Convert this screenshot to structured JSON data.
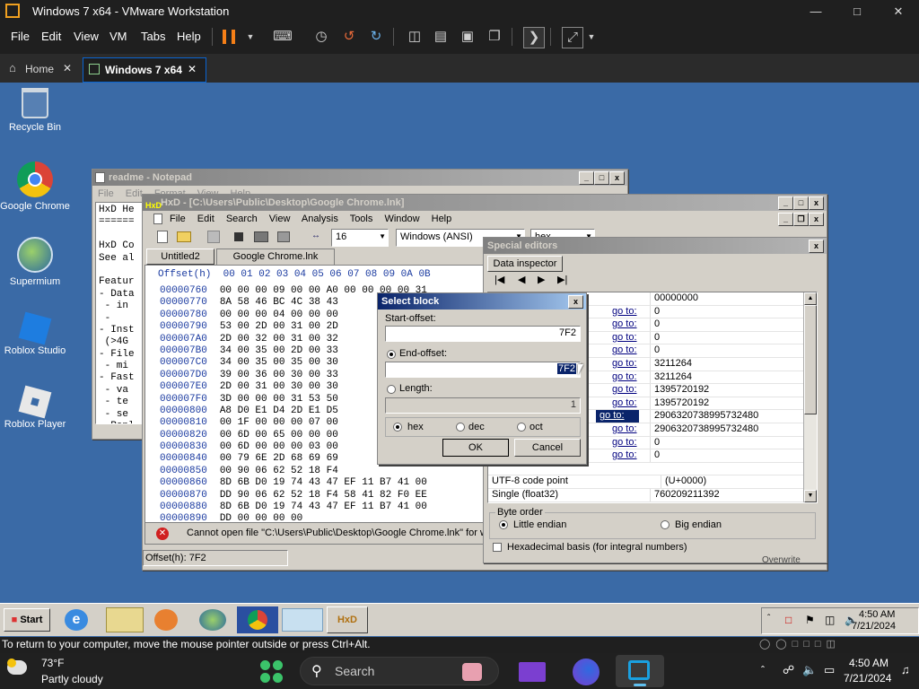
{
  "vmware": {
    "title": "Windows 7 x64 - VMware Workstation",
    "menu": [
      "File",
      "Edit",
      "View",
      "VM",
      "Tabs",
      "Help"
    ],
    "tabs": [
      {
        "label": "Home"
      },
      {
        "label": "Windows 7 x64"
      }
    ],
    "status_message": "To return to your computer, move the mouse pointer outside or press Ctrl+Alt."
  },
  "desktop": {
    "icons": [
      {
        "label": "Recycle Bin",
        "icon": "recycle-bin-icon"
      },
      {
        "label": "Google Chrome",
        "icon": "chrome-icon"
      },
      {
        "label": "Supermium",
        "icon": "supermium-icon"
      },
      {
        "label": "Roblox Studio",
        "icon": "roblox-studio-icon"
      },
      {
        "label": "Roblox Player",
        "icon": "roblox-player-icon"
      }
    ]
  },
  "notepad": {
    "title": "readme - Notepad",
    "menu": [
      "File",
      "Edit",
      "Format",
      "View",
      "Help"
    ],
    "lines": [
      "HxD He",
      "======",
      "",
      "HxD Co",
      "See al",
      "",
      "Featur",
      "- Data",
      " - in",
      " -",
      "- Inst",
      " (>4G",
      "- File",
      " - mi",
      "- Fast",
      " - va",
      " - te",
      " - se",
      "- Repl",
      "- Disk",
      " - us",
      " - au"
    ]
  },
  "hxd": {
    "title": "HxD - [C:\\Users\\Public\\Desktop\\Google Chrome.lnk]",
    "menu": [
      "File",
      "Edit",
      "Search",
      "View",
      "Analysis",
      "Tools",
      "Window",
      "Help"
    ],
    "bytes_per_row": "16",
    "encoding": "Windows (ANSI)",
    "base": "hex",
    "tabs": [
      "Untitled2",
      "Google Chrome.lnk"
    ],
    "header": "Offset(h)  00 01 02 03 04 05 06 07 08 09 0A 0B",
    "rows": [
      {
        "offset": "00000760",
        "bytes": "00 00 00 09 00 00 A0 00 00 00 00 31"
      },
      {
        "offset": "00000770",
        "bytes": "8A 58 46 BC 4C 38 43"
      },
      {
        "offset": "00000780",
        "bytes": "00 00 00 04 00 00 00"
      },
      {
        "offset": "00000790",
        "bytes": "53 00 2D 00 31 00 2D"
      },
      {
        "offset": "000007A0",
        "bytes": "2D 00 32 00 31 00 32"
      },
      {
        "offset": "000007B0",
        "bytes": "34 00 35 00 2D 00 33"
      },
      {
        "offset": "000007C0",
        "bytes": "34 00 35 00 35 00 30"
      },
      {
        "offset": "000007D0",
        "bytes": "39 00 36 00 30 00 33"
      },
      {
        "offset": "000007E0",
        "bytes": "2D 00 31 00 30 00 30"
      },
      {
        "offset": "000007F0",
        "bytes": "3D 00 00 00 31 53 50"
      },
      {
        "offset": "00000800",
        "bytes": "A8 D0 E1 D4 2D E1 D5"
      },
      {
        "offset": "00000810",
        "bytes": "00 1F 00 00 00 07 00"
      },
      {
        "offset": "00000820",
        "bytes": "00 6D 00 65 00 00 00"
      },
      {
        "offset": "00000830",
        "bytes": "00 6D 00 00 00 03 00"
      },
      {
        "offset": "00000840",
        "bytes": "00 79 6E 2D 68 69 69"
      },
      {
        "offset": "00000850",
        "bytes": "00 90 06 62 52 18 F4"
      },
      {
        "offset": "00000860",
        "bytes": "8D 6B D0 19 74 43 47 EF 11 B7 41 00"
      },
      {
        "offset": "00000870",
        "bytes": "DD 90 06 62 52 18 F4 58 41 82 F0 EE"
      },
      {
        "offset": "00000880",
        "bytes": "8D 6B D0 19 74 43 47 EF 11 B7 41 00"
      },
      {
        "offset": "00000890",
        "bytes": "DD 00 00 00 00"
      }
    ],
    "error_message": "Cannot open file \"C:\\Users\\Public\\Desktop\\Google Chrome.lnk\" for wr",
    "status_offset": "Offset(h): 7F2"
  },
  "special_editors": {
    "title": "Special editors",
    "tab": "Data inspector",
    "goto_label": "go to:",
    "rows": [
      {
        "label": "",
        "goto": false,
        "value": "00000000"
      },
      {
        "label": "",
        "goto": true,
        "value": "0"
      },
      {
        "label": "",
        "goto": true,
        "value": "0"
      },
      {
        "label": "",
        "goto": true,
        "value": "0"
      },
      {
        "label": "",
        "goto": true,
        "value": "0"
      },
      {
        "label": "",
        "goto": true,
        "value": "3211264"
      },
      {
        "label": "",
        "goto": true,
        "value": "3211264"
      },
      {
        "label": "",
        "goto": true,
        "value": "1395720192"
      },
      {
        "label": "",
        "goto": true,
        "value": "1395720192"
      },
      {
        "label": "",
        "goto": true,
        "value": "2906320738995732480"
      },
      {
        "label": "",
        "goto": true,
        "value": "2906320738995732480"
      },
      {
        "label": "",
        "goto": true,
        "value": "0"
      },
      {
        "label": "",
        "goto": true,
        "value": "0"
      },
      {
        "label": "",
        "goto": false,
        "value": ""
      },
      {
        "label": "UTF-8 code point",
        "goto": false,
        "value": "(U+0000)"
      },
      {
        "label": "Single (float32)",
        "goto": false,
        "value": "760209211392"
      }
    ],
    "byte_order_label": "Byte order",
    "little_endian": "Little endian",
    "big_endian": "Big endian",
    "hex_basis": "Hexadecimal basis (for integral numbers)",
    "overwrite": "Overwrite"
  },
  "select_block": {
    "title": "Select block",
    "start_label": "Start-offset:",
    "start_value": "7F2",
    "end_label": "End-offset:",
    "end_value": "7F2",
    "length_label": "Length:",
    "length_value": "1",
    "hex": "hex",
    "dec": "dec",
    "oct": "oct",
    "ok": "OK",
    "cancel": "Cancel"
  },
  "guest_taskbar": {
    "start": "Start",
    "time": "4:50 AM",
    "date": "7/21/2024"
  },
  "host_taskbar": {
    "temp": "73°F",
    "weather": "Partly cloudy",
    "search": "Search",
    "time": "4:50 AM",
    "date": "7/21/2024"
  },
  "colors": {
    "accent": "#0a64d0",
    "guest_desktop": "#3a6aa6",
    "pause": "#f57f17"
  }
}
